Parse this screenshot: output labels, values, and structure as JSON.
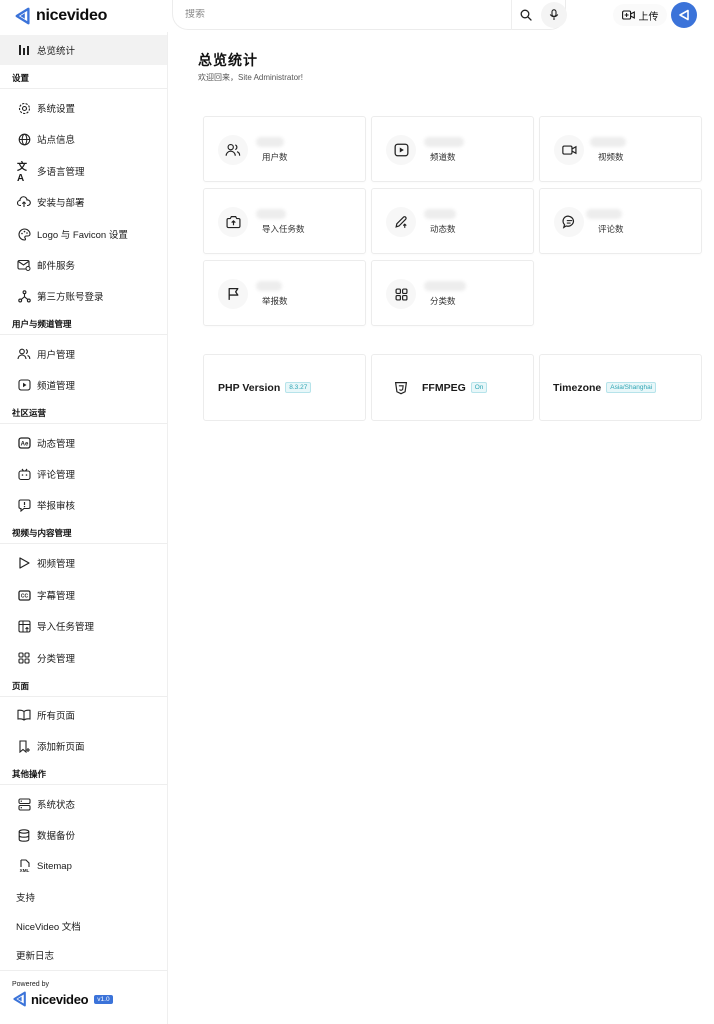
{
  "brand": {
    "name": "nicevideo",
    "color": "#3b73d9"
  },
  "header": {
    "search_placeholder": "搜索",
    "upload_label": "上传"
  },
  "sidebar": {
    "overview": "总览统计",
    "sections": {
      "settings": "设置",
      "users_channels": "用户与频道管理",
      "community": "社区运营",
      "video_content": "视频与内容管理",
      "pages": "页面",
      "other": "其他操作"
    },
    "items": {
      "system_settings": "系统设置",
      "site_info": "站点信息",
      "multilang": "多语言管理",
      "install_deploy": "安装与部署",
      "logo_favicon": "Logo 与 Favicon 设置",
      "mail_service": "邮件服务",
      "third_party_login": "第三方账号登录",
      "user_manage": "用户管理",
      "channel_manage": "频道管理",
      "post_manage": "动态管理",
      "comment_manage": "评论管理",
      "report_review": "举报审核",
      "video_manage": "视频管理",
      "subtitle_manage": "字幕管理",
      "import_task_manage": "导入任务管理",
      "category_manage": "分类管理",
      "all_pages": "所有页面",
      "add_page": "添加新页面",
      "system_status": "系统状态",
      "data_backup": "数据备份",
      "sitemap": "Sitemap",
      "support": "支持",
      "docs": "NiceVideo 文档",
      "changelog": "更新日志"
    },
    "footer": {
      "powered_by": "Powered by",
      "brand": "nicevideo",
      "version": "v1.0"
    }
  },
  "main": {
    "title": "总览统计",
    "subtitle": "欢迎回来，Site Administrator!",
    "stats": [
      {
        "label": "用户数",
        "icon": "users-icon"
      },
      {
        "label": "频道数",
        "icon": "play-square-icon"
      },
      {
        "label": "视频数",
        "icon": "video-camera-icon"
      },
      {
        "label": "导入任务数",
        "icon": "camera-upload-icon"
      },
      {
        "label": "动态数",
        "icon": "pen-icon"
      },
      {
        "label": "评论数",
        "icon": "chat-icon"
      },
      {
        "label": "举报数",
        "icon": "flag-icon"
      },
      {
        "label": "分类数",
        "icon": "grid-icon"
      }
    ],
    "system": [
      {
        "name": "PHP Version",
        "badge": "8.3.27"
      },
      {
        "name": "FFMPEG",
        "badge": "On"
      },
      {
        "name": "Timezone",
        "badge": "Asia/Shanghai"
      }
    ]
  }
}
